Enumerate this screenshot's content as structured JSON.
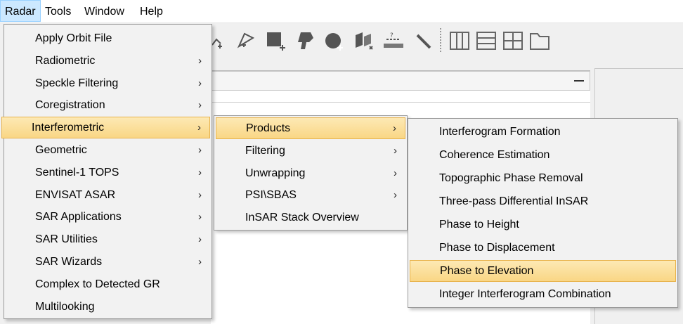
{
  "menubar": {
    "items": [
      {
        "label": "Radar"
      },
      {
        "label": "Tools"
      },
      {
        "label": "Window"
      },
      {
        "label": "Help"
      }
    ]
  },
  "toolbar": {
    "icons": [
      "polyline-tool-icon",
      "pin-tool-icon",
      "add-shape-icon",
      "geo-locate-icon",
      "add-circle-icon",
      "burst-tool-icon",
      "measure-icon",
      "wand-icon",
      "layout-vertical-icon",
      "layout-horizontal-icon",
      "layout-grid-icon",
      "folder-icon"
    ]
  },
  "radar_menu": {
    "items": [
      {
        "label": "Apply Orbit File",
        "submenu": false
      },
      {
        "label": "Radiometric",
        "submenu": true
      },
      {
        "label": "Speckle Filtering",
        "submenu": true
      },
      {
        "label": "Coregistration",
        "submenu": true
      },
      {
        "label": "Interferometric",
        "submenu": true
      },
      {
        "label": "Geometric",
        "submenu": true
      },
      {
        "label": "Sentinel-1 TOPS",
        "submenu": true
      },
      {
        "label": "ENVISAT ASAR",
        "submenu": true
      },
      {
        "label": "SAR Applications",
        "submenu": true
      },
      {
        "label": "SAR Utilities",
        "submenu": true
      },
      {
        "label": "SAR Wizards",
        "submenu": true
      },
      {
        "label": "Complex to Detected GR",
        "submenu": false
      },
      {
        "label": "Multilooking",
        "submenu": false
      }
    ],
    "highlighted": "Interferometric"
  },
  "interferometric_menu": {
    "items": [
      {
        "label": "Products",
        "submenu": true
      },
      {
        "label": "Filtering",
        "submenu": true
      },
      {
        "label": "Unwrapping",
        "submenu": true
      },
      {
        "label": "PSI\\SBAS",
        "submenu": true
      },
      {
        "label": "InSAR Stack Overview",
        "submenu": false
      }
    ],
    "highlighted": "Products"
  },
  "products_menu": {
    "items": [
      {
        "label": "Interferogram Formation"
      },
      {
        "label": "Coherence Estimation"
      },
      {
        "label": "Topographic Phase Removal"
      },
      {
        "label": "Three-pass Differential InSAR"
      },
      {
        "label": "Phase to Height"
      },
      {
        "label": "Phase to Displacement"
      },
      {
        "label": "Phase to Elevation"
      },
      {
        "label": "Integer Interferogram Combination"
      }
    ],
    "highlighted": "Phase to Elevation"
  },
  "glyphs": {
    "submenu_arrow": "›",
    "minimize": "—"
  },
  "colors": {
    "highlight": "#fbdc94",
    "highlight_border": "#e8b24a",
    "menubar_active": "#cce8ff"
  }
}
